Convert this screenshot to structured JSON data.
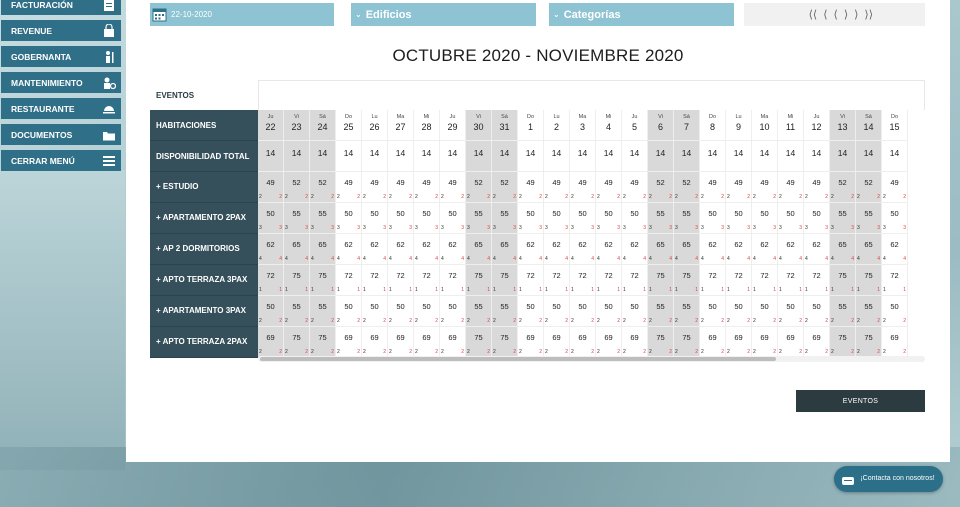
{
  "sidebar": {
    "items": [
      {
        "label": "FACTURACIÓN",
        "icon": "invoice-icon"
      },
      {
        "label": "REVENUE",
        "icon": "shopping-bag-icon"
      },
      {
        "label": "GOBERNANTA",
        "icon": "housekeeper-icon"
      },
      {
        "label": "MANTENIMIENTO",
        "icon": "maintenance-worker-icon"
      },
      {
        "label": "RESTAURANTE",
        "icon": "food-service-icon"
      },
      {
        "label": "DOCUMENTOS",
        "icon": "folder-icon"
      },
      {
        "label": "CERRAR MENÚ",
        "icon": "hamburger-menu-icon"
      }
    ]
  },
  "topbar": {
    "date": "22-10-2020",
    "buildings": "Edificios",
    "categories": "Categorías",
    "nav": [
      "⟨⟨",
      "⟨",
      "⟨",
      "⟩",
      "⟩",
      "⟩⟩"
    ]
  },
  "title": "OCTUBRE 2020 - NOVIEMBRE 2020",
  "grid": {
    "events_label": "EVENTOS",
    "habitaciones_label": "HABITACIONES",
    "disponibilidad_label": "DISPONIBILIDAD TOTAL",
    "days": [
      {
        "dow": "Ju",
        "num": "22",
        "we": true
      },
      {
        "dow": "Vi",
        "num": "23",
        "we": true
      },
      {
        "dow": "Sá",
        "num": "24",
        "we": true
      },
      {
        "dow": "Do",
        "num": "25",
        "we": false
      },
      {
        "dow": "Lu",
        "num": "26",
        "we": false
      },
      {
        "dow": "Ma",
        "num": "27",
        "we": false
      },
      {
        "dow": "Mi",
        "num": "28",
        "we": false
      },
      {
        "dow": "Ju",
        "num": "29",
        "we": false
      },
      {
        "dow": "Vi",
        "num": "30",
        "we": true
      },
      {
        "dow": "Sá",
        "num": "31",
        "we": true
      },
      {
        "dow": "Do",
        "num": "1",
        "we": false
      },
      {
        "dow": "Lu",
        "num": "2",
        "we": false
      },
      {
        "dow": "Ma",
        "num": "3",
        "we": false
      },
      {
        "dow": "Mi",
        "num": "4",
        "we": false
      },
      {
        "dow": "Ju",
        "num": "5",
        "we": false
      },
      {
        "dow": "Vi",
        "num": "6",
        "we": true
      },
      {
        "dow": "Sá",
        "num": "7",
        "we": true
      },
      {
        "dow": "Do",
        "num": "8",
        "we": false
      },
      {
        "dow": "Lu",
        "num": "9",
        "we": false
      },
      {
        "dow": "Ma",
        "num": "10",
        "we": false
      },
      {
        "dow": "Mi",
        "num": "11",
        "we": false
      },
      {
        "dow": "Ju",
        "num": "12",
        "we": false
      },
      {
        "dow": "Vi",
        "num": "13",
        "we": true
      },
      {
        "dow": "Sá",
        "num": "14",
        "we": true
      },
      {
        "dow": "Do",
        "num": "15",
        "we": false
      }
    ],
    "availability": [
      "14",
      "14",
      "14",
      "14",
      "14",
      "14",
      "14",
      "14",
      "14",
      "14",
      "14",
      "14",
      "14",
      "14",
      "14",
      "14",
      "14",
      "14",
      "14",
      "14",
      "14",
      "14",
      "14",
      "14",
      "14"
    ],
    "categories": [
      {
        "name": "+ ESTUDIO",
        "sub": "2",
        "prices": [
          "49",
          "52",
          "52",
          "49",
          "49",
          "49",
          "49",
          "49",
          "52",
          "52",
          "49",
          "49",
          "49",
          "49",
          "49",
          "52",
          "52",
          "49",
          "49",
          "49",
          "49",
          "49",
          "52",
          "52",
          "49"
        ]
      },
      {
        "name": "+ APARTAMENTO 2PAX",
        "sub": "3",
        "prices": [
          "50",
          "55",
          "55",
          "50",
          "50",
          "50",
          "50",
          "50",
          "55",
          "55",
          "50",
          "50",
          "50",
          "50",
          "50",
          "55",
          "55",
          "50",
          "50",
          "50",
          "50",
          "50",
          "55",
          "55",
          "50"
        ]
      },
      {
        "name": "+ AP 2 DORMITORIOS",
        "sub": "4",
        "prices": [
          "62",
          "65",
          "65",
          "62",
          "62",
          "62",
          "62",
          "62",
          "65",
          "65",
          "62",
          "62",
          "62",
          "62",
          "62",
          "65",
          "65",
          "62",
          "62",
          "62",
          "62",
          "62",
          "65",
          "65",
          "62"
        ]
      },
      {
        "name": "+ APTO TERRAZA 3PAX",
        "sub": "1",
        "prices": [
          "72",
          "75",
          "75",
          "72",
          "72",
          "72",
          "72",
          "72",
          "75",
          "75",
          "72",
          "72",
          "72",
          "72",
          "72",
          "75",
          "75",
          "72",
          "72",
          "72",
          "72",
          "72",
          "75",
          "75",
          "72"
        ]
      },
      {
        "name": "+ APARTAMENTO 3PAX",
        "sub": "2",
        "prices": [
          "50",
          "55",
          "55",
          "50",
          "50",
          "50",
          "50",
          "50",
          "55",
          "55",
          "50",
          "50",
          "50",
          "50",
          "50",
          "55",
          "55",
          "50",
          "50",
          "50",
          "50",
          "50",
          "55",
          "55",
          "50"
        ]
      },
      {
        "name": "+ APTO TERRAZA 2PAX",
        "sub": "2",
        "prices": [
          "69",
          "75",
          "75",
          "69",
          "69",
          "69",
          "69",
          "69",
          "75",
          "75",
          "69",
          "69",
          "69",
          "69",
          "69",
          "75",
          "75",
          "69",
          "69",
          "69",
          "69",
          "69",
          "75",
          "75",
          "69"
        ]
      }
    ]
  },
  "events_button": "EVENTOS",
  "contact": {
    "label": "¡Contacta con nosotros!",
    "icon": "chat-icon"
  },
  "colors": {
    "sidebar": "#2f6f88",
    "topbar": "#8dc3d2",
    "label_bg": "#35505a",
    "weekend": "#d9d9d9"
  }
}
